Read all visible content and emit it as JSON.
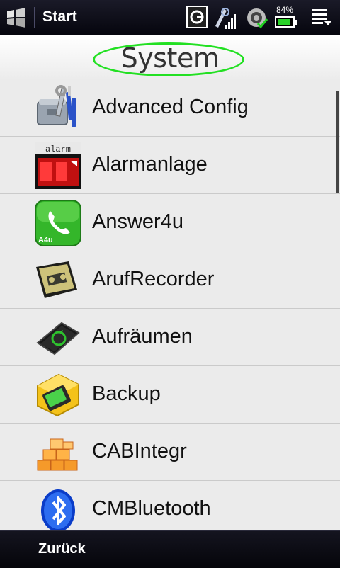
{
  "status_bar": {
    "title": "Start",
    "battery_percent_text": "84%",
    "battery_level": 0.84,
    "icons": [
      "windows-start-icon",
      "gprs-icon",
      "signal-strength-icon",
      "sync-icon",
      "battery-icon",
      "menu-icon"
    ]
  },
  "header": {
    "title": "System"
  },
  "list": {
    "items": [
      {
        "label": "Advanced Config",
        "icon": "tools-icon"
      },
      {
        "label": "Alarmanlage",
        "icon": "alarm-icon"
      },
      {
        "label": "Answer4u",
        "icon": "phone-icon"
      },
      {
        "label": "ArufRecorder",
        "icon": "tape-recorder-icon"
      },
      {
        "label": "Aufräumen",
        "icon": "memory-cleanup-icon"
      },
      {
        "label": "Backup",
        "icon": "backup-box-icon"
      },
      {
        "label": "CABIntegr",
        "icon": "cab-blocks-icon"
      },
      {
        "label": "CMBluetooth",
        "icon": "bluetooth-icon"
      }
    ],
    "icon_texts": {
      "alarm": "alarm",
      "answer4u": "A4u"
    }
  },
  "bottom_bar": {
    "back_label": "Zurück"
  },
  "colors": {
    "header_highlight": "#22e022",
    "list_bg": "#ebebeb",
    "bar_bg": "#0a0a14"
  }
}
